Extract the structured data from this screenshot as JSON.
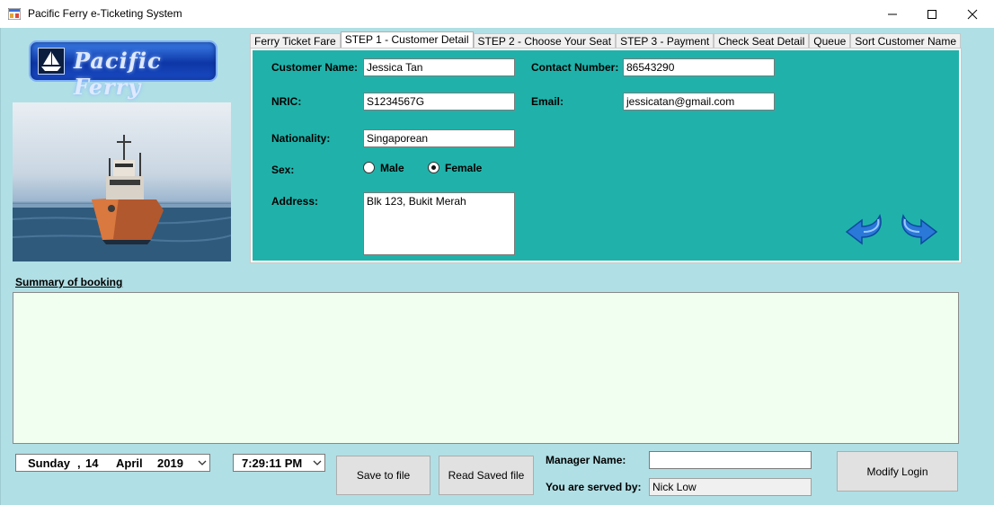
{
  "window": {
    "title": "Pacific Ferry e-Ticketing System"
  },
  "logo": {
    "text": "Pacific Ferry"
  },
  "tabs": [
    {
      "label": "Ferry Ticket Fare",
      "active": false
    },
    {
      "label": "STEP 1 - Customer Detail",
      "active": true
    },
    {
      "label": "STEP 2 - Choose Your Seat",
      "active": false
    },
    {
      "label": "STEP 3 - Payment",
      "active": false
    },
    {
      "label": "Check Seat Detail",
      "active": false
    },
    {
      "label": "Queue",
      "active": false
    },
    {
      "label": "Sort Customer Name",
      "active": false
    }
  ],
  "form": {
    "customer_name_label": "Customer Name:",
    "customer_name": "Jessica Tan",
    "contact_label": "Contact Number:",
    "contact": "86543290",
    "nric_label": "NRIC:",
    "nric": "S1234567G",
    "email_label": "Email:",
    "email": "jessicatan@gmail.com",
    "nationality_label": "Nationality:",
    "nationality": "Singaporean",
    "sex_label": "Sex:",
    "male_label": "Male",
    "female_label": "Female",
    "sex_selected": "Female",
    "address_label": "Address:",
    "address": "Blk 123, Bukit Merah"
  },
  "summary": {
    "title": "Summary of booking",
    "content": ""
  },
  "footer": {
    "date": {
      "weekday": "Sunday",
      "sep": ",",
      "day": "14",
      "month": "April",
      "year": "2019"
    },
    "time": "7:29:11 PM",
    "save_button": "Save to file",
    "read_button": "Read Saved file",
    "manager_label": "Manager Name:",
    "manager_value": "",
    "served_label": "You are served by:",
    "served_value": "Nick Low",
    "modify_button": "Modify Login"
  },
  "colors": {
    "background": "#b0dfe5",
    "tab_panel": "#20b2aa",
    "summary_bg": "#f0fff0"
  }
}
